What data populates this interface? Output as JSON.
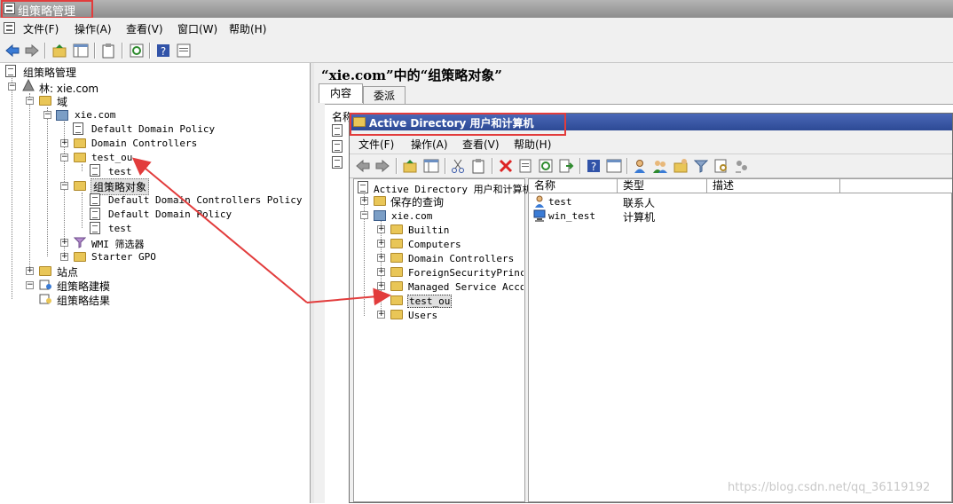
{
  "window": {
    "title": "组策略管理"
  },
  "menu": [
    "文件(F)",
    "操作(A)",
    "查看(V)",
    "窗口(W)",
    "帮助(H)"
  ],
  "left_tree": {
    "root": "组策略管理",
    "forest": "林: xie.com",
    "domains": "域",
    "domain": "xie.com",
    "ddp": "Default Domain Policy",
    "dc": "Domain Controllers",
    "test_ou": "test_ou",
    "test_ou_child": "test",
    "gpo_folder": "组策略对象",
    "gpo_items": [
      "Default Domain Controllers Policy",
      "Default Domain Policy",
      "test"
    ],
    "wmi": "WMI 筛选器",
    "starter": "Starter GPO",
    "sites": "站点",
    "modeling": "组策略建模",
    "results": "组策略结果"
  },
  "right_pane": {
    "title": "“xie.com”中的“组策略对象”",
    "tabs": [
      "内容",
      "委派"
    ],
    "col_partial": "名称"
  },
  "ad_window": {
    "title": "Active Directory 用户和计算机",
    "menu": [
      "文件(F)",
      "操作(A)",
      "查看(V)",
      "帮助(H)"
    ],
    "tree_root": "Active Directory 用户和计算机",
    "saved_queries": "保存的查询",
    "domain": "xie.com",
    "children": [
      "Builtin",
      "Computers",
      "Domain Controllers",
      "ForeignSecurityPrincip",
      "Managed Service Accour",
      "test_ou",
      "Users"
    ],
    "columns": [
      "名称",
      "类型",
      "描述"
    ],
    "rows": [
      {
        "name": "test",
        "type": "联系人",
        "icon": "contact-icon"
      },
      {
        "name": "win_test",
        "type": "计算机",
        "icon": "computer-icon"
      }
    ]
  },
  "watermark": "https://blog.csdn.net/qq_36119192",
  "colors": {
    "highlight": "#e23c3c",
    "ad_titlebar": "#2d4a95",
    "folder": "#e9c657"
  }
}
